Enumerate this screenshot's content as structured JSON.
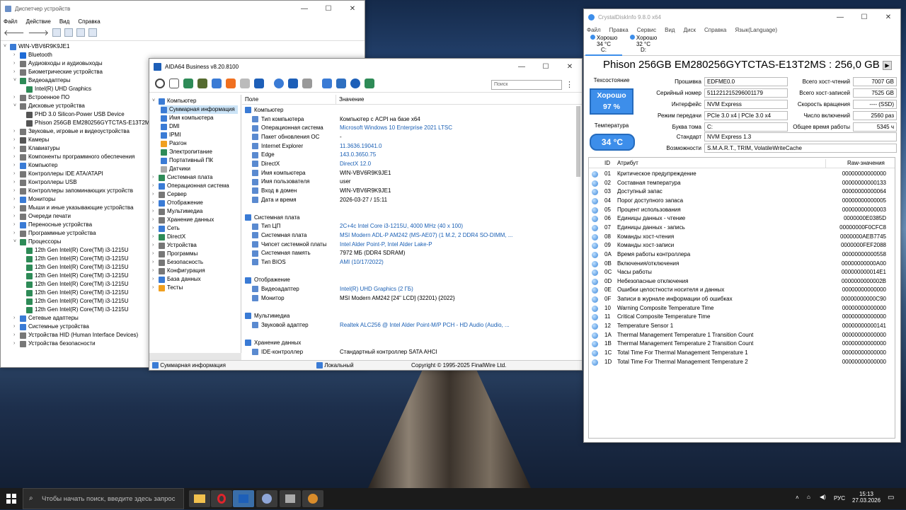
{
  "devmgr": {
    "title": "Диспетчер устройств",
    "menu": [
      "Файл",
      "Действие",
      "Вид",
      "Справка"
    ],
    "root": "WIN-VBV6R9K9JE1",
    "items": [
      {
        "label": "Bluetooth",
        "level": 1,
        "color": "#1e6bd6"
      },
      {
        "label": "Аудиовходы и аудиовыходы",
        "level": 1,
        "color": "#777"
      },
      {
        "label": "Биометрические устройства",
        "level": 1,
        "color": "#777"
      },
      {
        "label": "Видеоадаптеры",
        "level": 1,
        "color": "#2e8b57",
        "open": true
      },
      {
        "label": "Intel(R) UHD Graphics",
        "level": 2,
        "color": "#2e8b57"
      },
      {
        "label": "Встроенное ПО",
        "level": 1,
        "color": "#777"
      },
      {
        "label": "Дисковые устройства",
        "level": 1,
        "color": "#777",
        "open": true
      },
      {
        "label": "PHD 3.0 Silicon-Power USB Device",
        "level": 2,
        "color": "#555"
      },
      {
        "label": "Phison 256GB EM280256GYTCTAS-E13T2MS",
        "level": 2,
        "color": "#555"
      },
      {
        "label": "Звуковые, игровые и видеоустройства",
        "level": 1,
        "color": "#777"
      },
      {
        "label": "Камеры",
        "level": 1,
        "color": "#555"
      },
      {
        "label": "Клавиатуры",
        "level": 1,
        "color": "#777"
      },
      {
        "label": "Компоненты программного обеспечения",
        "level": 1,
        "color": "#777"
      },
      {
        "label": "Компьютер",
        "level": 1,
        "color": "#3a7bd5"
      },
      {
        "label": "Контроллеры IDE ATA/ATAPI",
        "level": 1,
        "color": "#777"
      },
      {
        "label": "Контроллеры USB",
        "level": 1,
        "color": "#777"
      },
      {
        "label": "Контроллеры запоминающих устройств",
        "level": 1,
        "color": "#777"
      },
      {
        "label": "Мониторы",
        "level": 1,
        "color": "#3a7bd5"
      },
      {
        "label": "Мыши и иные указывающие устройства",
        "level": 1,
        "color": "#777"
      },
      {
        "label": "Очереди печати",
        "level": 1,
        "color": "#777"
      },
      {
        "label": "Переносные устройства",
        "level": 1,
        "color": "#3a7bd5"
      },
      {
        "label": "Программные устройства",
        "level": 1,
        "color": "#777"
      },
      {
        "label": "Процессоры",
        "level": 1,
        "color": "#2e8b57",
        "open": true
      },
      {
        "label": "12th Gen Intel(R) Core(TM) i3-1215U",
        "level": 2,
        "color": "#2e8b57"
      },
      {
        "label": "12th Gen Intel(R) Core(TM) i3-1215U",
        "level": 2,
        "color": "#2e8b57"
      },
      {
        "label": "12th Gen Intel(R) Core(TM) i3-1215U",
        "level": 2,
        "color": "#2e8b57"
      },
      {
        "label": "12th Gen Intel(R) Core(TM) i3-1215U",
        "level": 2,
        "color": "#2e8b57"
      },
      {
        "label": "12th Gen Intel(R) Core(TM) i3-1215U",
        "level": 2,
        "color": "#2e8b57"
      },
      {
        "label": "12th Gen Intel(R) Core(TM) i3-1215U",
        "level": 2,
        "color": "#2e8b57"
      },
      {
        "label": "12th Gen Intel(R) Core(TM) i3-1215U",
        "level": 2,
        "color": "#2e8b57"
      },
      {
        "label": "12th Gen Intel(R) Core(TM) i3-1215U",
        "level": 2,
        "color": "#2e8b57"
      },
      {
        "label": "Сетевые адаптеры",
        "level": 1,
        "color": "#3a7bd5"
      },
      {
        "label": "Системные устройства",
        "level": 1,
        "color": "#3a7bd5"
      },
      {
        "label": "Устройства HID (Human Interface Devices)",
        "level": 1,
        "color": "#777"
      },
      {
        "label": "Устройства безопасности",
        "level": 1,
        "color": "#777"
      }
    ]
  },
  "aida": {
    "title": "AIDA64 Business v8.20.8100",
    "search_placeholder": "Поиск",
    "tree": [
      {
        "label": "Компьютер",
        "level": 0,
        "color": "#3a7bd5",
        "open": true
      },
      {
        "label": "Суммарная информация",
        "level": 1,
        "color": "#3a7bd5",
        "selected": true
      },
      {
        "label": "Имя компьютера",
        "level": 1,
        "color": "#3a7bd5"
      },
      {
        "label": "DMI",
        "level": 1,
        "color": "#3a7bd5"
      },
      {
        "label": "IPMI",
        "level": 1,
        "color": "#3a7bd5"
      },
      {
        "label": "Разгон",
        "level": 1,
        "color": "#f0a020"
      },
      {
        "label": "Электропитание",
        "level": 1,
        "color": "#2e8b57"
      },
      {
        "label": "Портативный ПК",
        "level": 1,
        "color": "#3a7bd5"
      },
      {
        "label": "Датчики",
        "level": 1,
        "color": "#aaa"
      },
      {
        "label": "Системная плата",
        "level": 0,
        "color": "#2e8b57"
      },
      {
        "label": "Операционная система",
        "level": 0,
        "color": "#3a7bd5"
      },
      {
        "label": "Сервер",
        "level": 0,
        "color": "#777"
      },
      {
        "label": "Отображение",
        "level": 0,
        "color": "#3a7bd5"
      },
      {
        "label": "Мультимедиа",
        "level": 0,
        "color": "#777"
      },
      {
        "label": "Хранение данных",
        "level": 0,
        "color": "#777"
      },
      {
        "label": "Сеть",
        "level": 0,
        "color": "#3a7bd5"
      },
      {
        "label": "DirectX",
        "level": 0,
        "color": "#2e8b57"
      },
      {
        "label": "Устройства",
        "level": 0,
        "color": "#777"
      },
      {
        "label": "Программы",
        "level": 0,
        "color": "#777"
      },
      {
        "label": "Безопасность",
        "level": 0,
        "color": "#777"
      },
      {
        "label": "Конфигурация",
        "level": 0,
        "color": "#777"
      },
      {
        "label": "База данных",
        "level": 0,
        "color": "#3a7bd5"
      },
      {
        "label": "Тесты",
        "level": 0,
        "color": "#f0a020"
      }
    ],
    "col_field": "Поле",
    "col_value": "Значение",
    "rows": [
      {
        "type": "group",
        "field": "Компьютер"
      },
      {
        "field": "Тип компьютера",
        "value": "Компьютер с ACPI на базе x64",
        "link": false
      },
      {
        "field": "Операционная система",
        "value": "Microsoft Windows 10 Enterprise 2021 LTSC",
        "link": true
      },
      {
        "field": "Пакет обновления ОС",
        "value": "-",
        "link": false
      },
      {
        "field": "Internet Explorer",
        "value": "11.3636.19041.0",
        "link": true
      },
      {
        "field": "Edge",
        "value": "143.0.3650.75",
        "link": true
      },
      {
        "field": "DirectX",
        "value": "DirectX 12.0",
        "link": true
      },
      {
        "field": "Имя компьютера",
        "value": "WIN-VBV6R9K9JE1",
        "link": false
      },
      {
        "field": "Имя пользователя",
        "value": "user",
        "link": false
      },
      {
        "field": "Вход в домен",
        "value": "WIN-VBV6R9K9JE1",
        "link": false
      },
      {
        "field": "Дата и время",
        "value": "2026-03-27 / 15:11",
        "link": false
      },
      {
        "type": "gap"
      },
      {
        "type": "group",
        "field": "Системная плата"
      },
      {
        "field": "Тип ЦП",
        "value": "2C+4c Intel Core i3-1215U, 4000 MHz (40 x 100)",
        "link": true
      },
      {
        "field": "Системная плата",
        "value": "MSI Modern ADL-P AM242 (MS-AE07)  (1 M.2, 2 DDR4 SO-DIMM, ...",
        "link": true
      },
      {
        "field": "Чипсет системной платы",
        "value": "Intel Alder Point-P, Intel Alder Lake-P",
        "link": true
      },
      {
        "field": "Системная память",
        "value": "7972 МБ  (DDR4 SDRAM)",
        "link": false
      },
      {
        "field": "Тип BIOS",
        "value": "AMI (10/17/2022)",
        "link": true
      },
      {
        "type": "gap"
      },
      {
        "type": "group",
        "field": "Отображение"
      },
      {
        "field": "Видеоадаптер",
        "value": "Intel(R) UHD Graphics  (2 ГБ)",
        "link": true
      },
      {
        "field": "Монитор",
        "value": "MSI Modern AM242  [24\" LCD]  (32201)  {2022}",
        "link": false
      },
      {
        "type": "gap"
      },
      {
        "type": "group",
        "field": "Мультимедиа"
      },
      {
        "field": "Звуковой адаптер",
        "value": "Realtek ALC256 @ Intel Alder Point-M/P PCH - HD Audio (Audio, ...",
        "link": true
      },
      {
        "type": "gap"
      },
      {
        "type": "group",
        "field": "Хранение данных"
      },
      {
        "field": "IDE-контроллер",
        "value": "Стандартный контроллер SATA AHCI",
        "link": false
      }
    ],
    "status_left": "Суммарная информация",
    "status_mid": "Локальный",
    "status_right": "Copyright © 1995-2025 FinalWire Ltd."
  },
  "cdi": {
    "title": "CrystalDiskInfo 9.8.0 x64",
    "menu": [
      "Файл",
      "Правка",
      "Сервис",
      "Вид",
      "Диск",
      "Справка",
      "Язык(Language)"
    ],
    "drives": [
      {
        "status": "Хорошо",
        "temp": "34 °C",
        "letter": "C:"
      },
      {
        "status": "Хорошо",
        "temp": "32 °C",
        "letter": "D:"
      }
    ],
    "heading": "Phison 256GB EM280256GYTCTAS-E13T2MS : 256,0 GB",
    "health_label": "Техсостояние",
    "health_status": "Хорошо",
    "health_pct": "97 %",
    "temp_label": "Температура",
    "temp_value": "34 °C",
    "left": [
      {
        "label": "Прошивка",
        "value": "EDFME0.0"
      },
      {
        "label": "Серийный номер",
        "value": "511221215296001179"
      },
      {
        "label": "Интерфейс",
        "value": "NVM Express"
      },
      {
        "label": "Режим передачи",
        "value": "PCIe 3.0 x4 | PCIe 3.0 x4"
      },
      {
        "label": "Буква тома",
        "value": "C:"
      }
    ],
    "right": [
      {
        "label": "Всего хост-чтений",
        "value": "7007 GB"
      },
      {
        "label": "Всего хост-записей",
        "value": "7525 GB"
      },
      {
        "label": "Скорость вращения",
        "value": "---- (SSD)"
      },
      {
        "label": "Число включений",
        "value": "2560 раз"
      },
      {
        "label": "Общее время работы",
        "value": "5345 ч"
      }
    ],
    "standard_label": "Стандарт",
    "standard": "NVM Express 1.3",
    "features_label": "Возможности",
    "features": "S.M.A.R.T., TRIM, VolatileWriteCache",
    "cols": [
      "ID",
      "Атрибут",
      "Raw-значения"
    ],
    "smart": [
      [
        "01",
        "Критическое предупреждение",
        "00000000000000"
      ],
      [
        "02",
        "Составная температура",
        "00000000000133"
      ],
      [
        "03",
        "Доступный запас",
        "00000000000064"
      ],
      [
        "04",
        "Порог доступного запаса",
        "00000000000005"
      ],
      [
        "05",
        "Процент использования",
        "00000000000003"
      ],
      [
        "06",
        "Единицы данных - чтение",
        "0000000E0385D"
      ],
      [
        "07",
        "Единицы данных - запись",
        "00000000F0CFC8"
      ],
      [
        "08",
        "Команды хост-чтения",
        "0000000AEB7745"
      ],
      [
        "09",
        "Команды хост-записи",
        "0000000FEF2088"
      ],
      [
        "0A",
        "Время работы контроллера",
        "00000000000558"
      ],
      [
        "0B",
        "Включения/отключения",
        "00000000000A00"
      ],
      [
        "0C",
        "Часы работы",
        "000000000014E1"
      ],
      [
        "0D",
        "Небезопасные отключения",
        "0000000000002B"
      ],
      [
        "0E",
        "Ошибки целостности носителя и данных",
        "00000000000000"
      ],
      [
        "0F",
        "Записи в журнале информации об ошибках",
        "00000000000C90"
      ],
      [
        "10",
        "Warning Composite Temperature Time",
        "00000000000000"
      ],
      [
        "11",
        "Critical Composite Temperature Time",
        "00000000000000"
      ],
      [
        "12",
        "Temperature Sensor 1",
        "00000000000141"
      ],
      [
        "1A",
        "Thermal Management Temperature 1 Transition Count",
        "00000000000000"
      ],
      [
        "1B",
        "Thermal Management Temperature 2 Transition Count",
        "00000000000000"
      ],
      [
        "1C",
        "Total Time For Thermal Management Temperature 1",
        "00000000000000"
      ],
      [
        "1D",
        "Total Time For Thermal Management Temperature 2",
        "00000000000000"
      ]
    ]
  },
  "taskbar": {
    "search_placeholder": "Чтобы начать поиск, введите здесь запрос",
    "lang": "РУС",
    "time": "15:13",
    "date": "27.03.2026"
  }
}
